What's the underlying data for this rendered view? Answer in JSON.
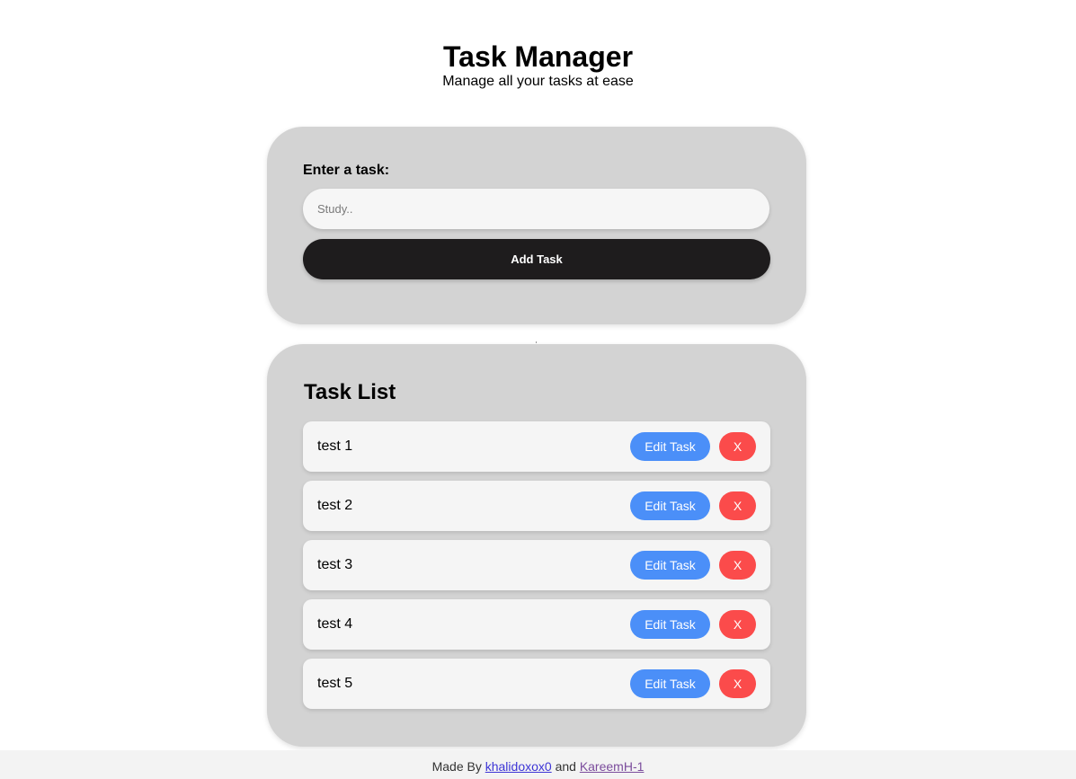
{
  "header": {
    "title": "Task Manager",
    "subtitle": "Manage all your tasks at ease"
  },
  "add_form": {
    "label": "Enter a task:",
    "input_value": "",
    "input_placeholder": "Study..",
    "button_label": "Add Task"
  },
  "task_list": {
    "title": "Task List",
    "edit_label": "Edit Task",
    "delete_label": "X",
    "items": [
      {
        "text": "test 1"
      },
      {
        "text": "test 2"
      },
      {
        "text": "test 3"
      },
      {
        "text": "test 4"
      },
      {
        "text": "test 5"
      }
    ]
  },
  "footer": {
    "prefix": "Made By",
    "author_1": "khalidoxox0",
    "joiner": "and",
    "author_2": "KareemH-1"
  },
  "colors": {
    "card_bg": "#d3d3d3",
    "primary_dark": "#1e1c1d",
    "edit_blue": "#4b8ff8",
    "delete_red": "#fb4b4b"
  }
}
